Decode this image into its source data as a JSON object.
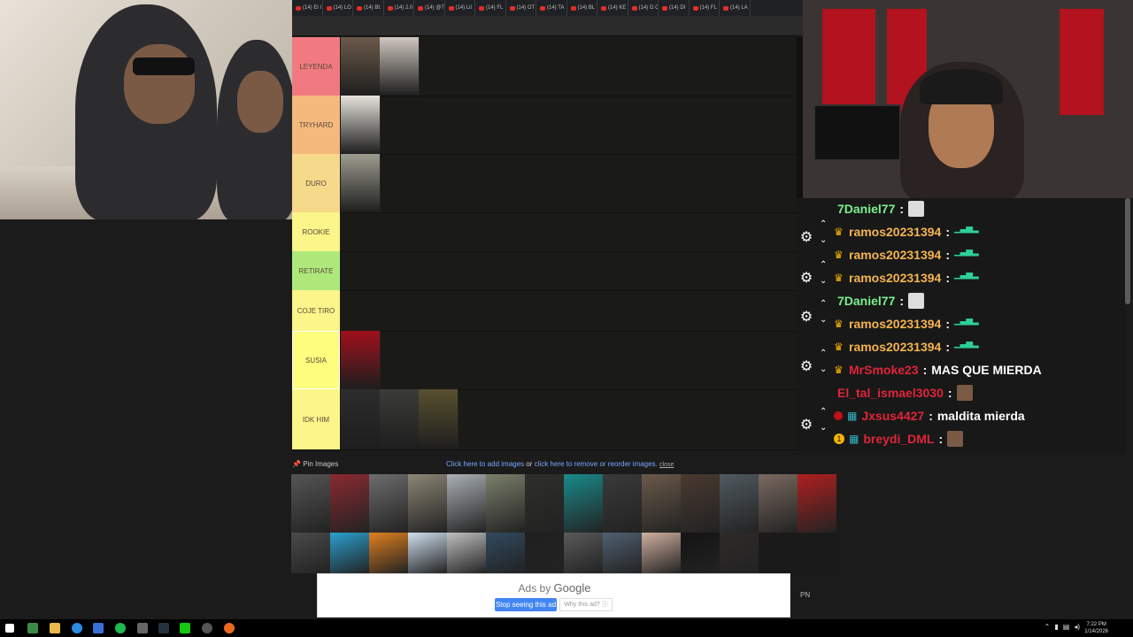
{
  "browser": {
    "tabs": [
      "(14) El I",
      "(14) LO",
      "(14) Bl:",
      "(14) 2.0",
      "(14) @T",
      "(14) Lil",
      "(14) FL",
      "(14) OT",
      "(14) TA",
      "(14) BL",
      "(14) KE",
      "(14) G C",
      "(14) DI",
      "(14) FL",
      "(14) LA"
    ]
  },
  "tier_list": {
    "rows": [
      {
        "label": "LEYENDA",
        "color": "#f07a80"
      },
      {
        "label": "TRYHARD",
        "color": "#f5b97d"
      },
      {
        "label": "DURO",
        "color": "#f6d98a"
      },
      {
        "label": "ROOKIE",
        "color": "#fbf58a"
      },
      {
        "label": "RETIRATE",
        "color": "#aee87b"
      },
      {
        "label": "COJE TIRO",
        "color": "#fbf58a"
      },
      {
        "label": "SUSIA",
        "color": "#fdfd7e"
      },
      {
        "label": "IDK HIM",
        "color": "#fbf58a"
      }
    ],
    "pin_label": "Pin Images",
    "add_link": "Click here to add images",
    "or_text": "or",
    "remove_link": "click here to remove or reorder images.",
    "close_label": "close"
  },
  "chat": {
    "messages": [
      {
        "user": "7Daniel77",
        "color": "#7cf08d",
        "crown": false,
        "emote": "face-light",
        "text": ""
      },
      {
        "user": "ramos20231394",
        "color": "#f5b450",
        "crown": true,
        "emote": "bars",
        "text": ""
      },
      {
        "user": "ramos20231394",
        "color": "#f5b450",
        "crown": true,
        "emote": "bars",
        "text": ""
      },
      {
        "user": "ramos20231394",
        "color": "#f5b450",
        "crown": true,
        "emote": "bars",
        "text": ""
      },
      {
        "user": "7Daniel77",
        "color": "#7cf08d",
        "crown": false,
        "emote": "face-light",
        "text": ""
      },
      {
        "user": "ramos20231394",
        "color": "#f5b450",
        "crown": true,
        "emote": "bars",
        "text": ""
      },
      {
        "user": "ramos20231394",
        "color": "#f5b450",
        "crown": true,
        "emote": "bars",
        "text": ""
      },
      {
        "user": "MrSmoke23",
        "color": "#e0253a",
        "crown": true,
        "emote": "",
        "text": "MAS QUE MIERDA"
      },
      {
        "user": "El_tal_ismael3030",
        "color": "#e0253a",
        "crown": false,
        "emote": "face",
        "text": ""
      },
      {
        "user": "Jxsus4427",
        "color": "#e0253a",
        "crown": false,
        "emote": "",
        "text": "maldita mierda"
      },
      {
        "user": "breydi_DML",
        "color": "#e0253a",
        "crown": false,
        "emote": "face",
        "text": ""
      }
    ],
    "emote_bars": "▁▃▅▂"
  },
  "ad": {
    "ads_by": "Ads by",
    "google": "Google",
    "stop_label": "Stop seeing this ad",
    "why_label": "Why this ad? ⓘ"
  },
  "pn_label": "PN",
  "taskbar": {
    "time": "7:22 PM",
    "date": "1/14/2026"
  },
  "colors": {
    "tier_bg": "#1a1a17",
    "chat_bg": "#181818",
    "accent_blue": "#4285f4"
  }
}
